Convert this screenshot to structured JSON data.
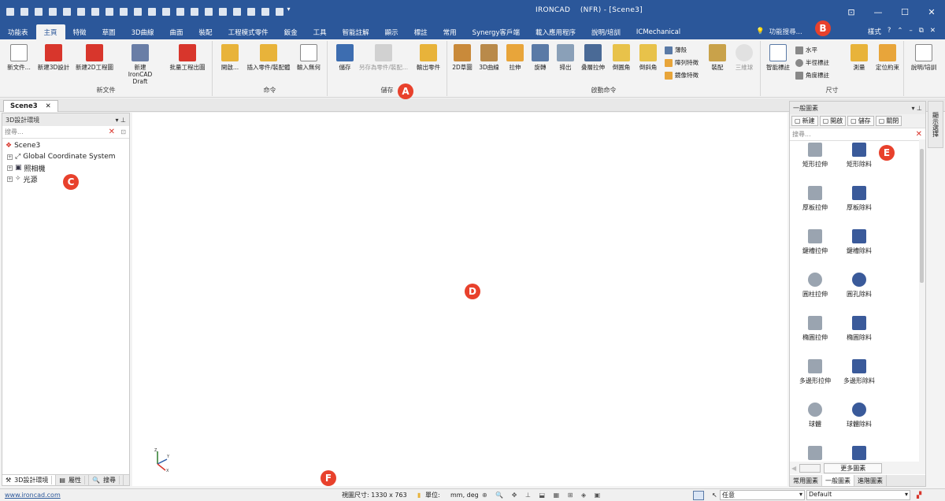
{
  "title_bar": {
    "title": "IRONCAD",
    "mode": "(NFR)",
    "document": "[Scene3]"
  },
  "menu_tabs": [
    "功能表",
    "主頁",
    "特徵",
    "草圖",
    "3D曲線",
    "曲面",
    "裝配",
    "工程模式零件",
    "鈑金",
    "工具",
    "智能註解",
    "顯示",
    "標註",
    "常用",
    "Synergy客戶端",
    "載入應用程序",
    "說明/培訓",
    "ICMechanical"
  ],
  "active_tab_index": 1,
  "search_hint": "功能搜尋...",
  "right_menu": {
    "style": "樣式",
    "help": "?"
  },
  "ribbon": {
    "groups": [
      {
        "label": "新文件",
        "buttons": [
          "新文件...",
          "新建3D設計",
          "新建2D工程圖",
          "新建IronCAD Draft",
          "批量工程出圖"
        ]
      },
      {
        "label": "命令",
        "buttons": [
          "開啟...",
          "插入零件/裝配體",
          "輸入無何"
        ]
      },
      {
        "label": "儲存",
        "buttons": [
          "儲存",
          "另存為零件/裝配...",
          "輸出零件"
        ]
      },
      {
        "label": "啟動命令",
        "buttons": [
          "2D草圖",
          "3D曲線",
          "拉伸",
          "旋轉",
          "掃出",
          "叠層拉伸",
          "倒圓角",
          "倒斜角"
        ],
        "small": [
          "薄殼",
          "陣列特徵",
          "鏡像特徵"
        ],
        "extra": [
          "裝配",
          "三維球"
        ]
      },
      {
        "label": "尺寸",
        "buttons": [
          "智能標註"
        ],
        "small": [
          "水平",
          "半徑標註",
          "角度標註"
        ],
        "extra": [
          "測量",
          "定位約束"
        ]
      },
      {
        "label": "",
        "buttons": [
          "說明/培訓"
        ]
      }
    ]
  },
  "doc_tab": {
    "name": "Scene3"
  },
  "left_panel": {
    "title": "3D設計環境",
    "search_placeholder": "搜尋...",
    "tree": [
      "Scene3",
      "Global Coordinate System",
      "照相機",
      "光源"
    ],
    "footer_tabs": [
      "3D設計環境",
      "屬性",
      "搜尋"
    ]
  },
  "right_panel": {
    "title": "一般圖素",
    "toolbar": [
      "新建",
      "開啟",
      "儲存",
      "關閉"
    ],
    "search_placeholder": "搜尋...",
    "items": [
      "矩形拉伸",
      "矩形除料",
      "厚板拉伸",
      "厚板除料",
      "鍵槽拉伸",
      "鍵槽除料",
      "圓柱拉伸",
      "圓孔除料",
      "橢圓拉伸",
      "橢圓除料",
      "多邊形拉伸",
      "多邊形除料",
      "球體",
      "球體除料",
      "45度旋轉",
      "45度旋轉除"
    ],
    "more_button": "更多圖素",
    "bottom_tabs": [
      "常用圖素",
      "一般圖素",
      "進階圖素"
    ],
    "side_strip": "顯示選擇"
  },
  "status_bar": {
    "website": "www.ironcad.com",
    "view_size_label": "視圖尺寸: 1330 x 763",
    "unit_label": "單位:",
    "unit_value": "mm, deg",
    "selector1": "任意",
    "selector2": "Default"
  },
  "markers": [
    "A",
    "B",
    "C",
    "D",
    "E",
    "F"
  ],
  "colors": {
    "title_bar": "#2b579a",
    "marker": "#e8412c"
  }
}
